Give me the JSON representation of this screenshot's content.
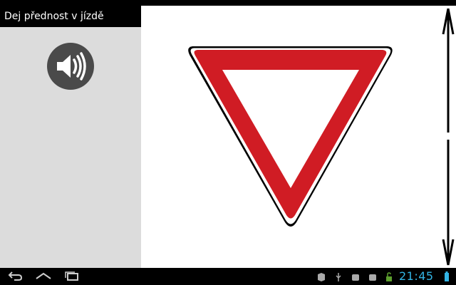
{
  "app": {
    "title": "Dej přednost v jízdě"
  },
  "sidebar": {
    "speaker": {
      "icon": "speaker-icon"
    }
  },
  "sign": {
    "icon": "yield-sign-icon",
    "colors": {
      "border": "#d01c24",
      "outline": "#000000",
      "fill": "#ffffff"
    }
  },
  "scroll": {
    "up_icon": "arrow-up-icon",
    "down_icon": "arrow-down-icon"
  },
  "navbar": {
    "back_icon": "back-icon",
    "home_icon": "home-icon",
    "recents_icon": "recent-apps-icon",
    "tray_icons": [
      "notification-icon",
      "usb-icon",
      "notification-icon",
      "notification-icon",
      "lock-icon"
    ],
    "time": "21:45",
    "accent": "#33b5e5"
  }
}
